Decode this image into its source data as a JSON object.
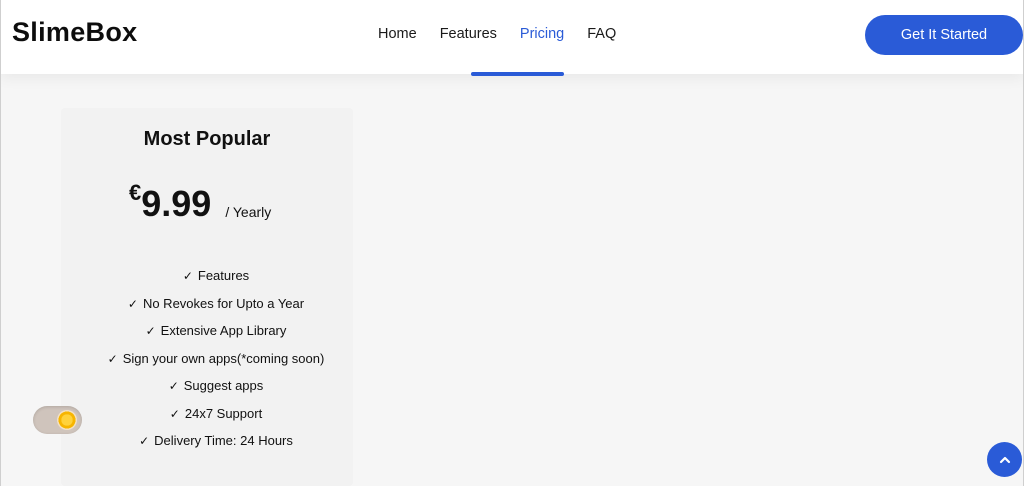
{
  "header": {
    "logo": "SlimeBox",
    "nav": [
      {
        "label": "Home",
        "active": false
      },
      {
        "label": "Features",
        "active": false
      },
      {
        "label": "Pricing",
        "active": true
      },
      {
        "label": "FAQ",
        "active": false
      }
    ],
    "cta_label": "Get It Started"
  },
  "pricing_card": {
    "title": "Most Popular",
    "currency": "€",
    "amount": "9.99",
    "period": "/ Yearly",
    "features": [
      "Features",
      "No Revokes for Upto a Year",
      "Extensive App Library",
      "Sign your own apps(*coming soon)",
      "Suggest apps",
      "24x7 Support",
      "Delivery Time: 24 Hours"
    ],
    "check_icon": "✓"
  },
  "colors": {
    "accent": "#2a5bd7",
    "background": "#f6f6f6",
    "card": "#f2f2f2"
  },
  "icons": {
    "theme_toggle": "sun-icon",
    "scroll_top": "chevron-up-icon"
  }
}
